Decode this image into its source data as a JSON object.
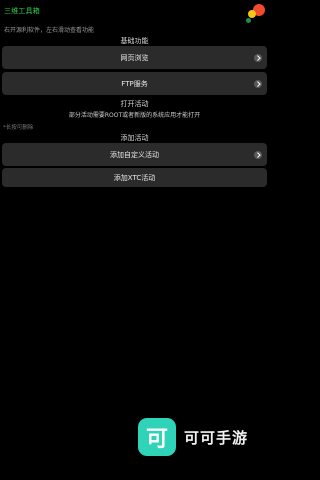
{
  "header": {
    "app_title": "三维工具箱",
    "hint": "右开源利软件，左右滑动查看功能"
  },
  "sections": {
    "basic": {
      "title": "基础功能",
      "buttons": [
        {
          "label": "网页浏览"
        },
        {
          "label": "FTP服务"
        }
      ]
    },
    "open_activity": {
      "title": "打开活动",
      "subtext": "部分活动需要ROOT或者新版的系统应用才能打开",
      "note": "*长按可删除"
    },
    "add_activity": {
      "title": "添加活动",
      "buttons": [
        {
          "label": "添加自定义活动"
        },
        {
          "label": "添加XTC活动"
        }
      ]
    }
  },
  "watermark": {
    "logo_char": "可",
    "text": "可可手游"
  },
  "colors": {
    "background": "#000000",
    "button_bg": "#2b2b2b",
    "title_green": "#2fd14a",
    "watermark_teal": "#2ed3b8"
  },
  "icons": {
    "chevron": "chevron-right-icon"
  }
}
